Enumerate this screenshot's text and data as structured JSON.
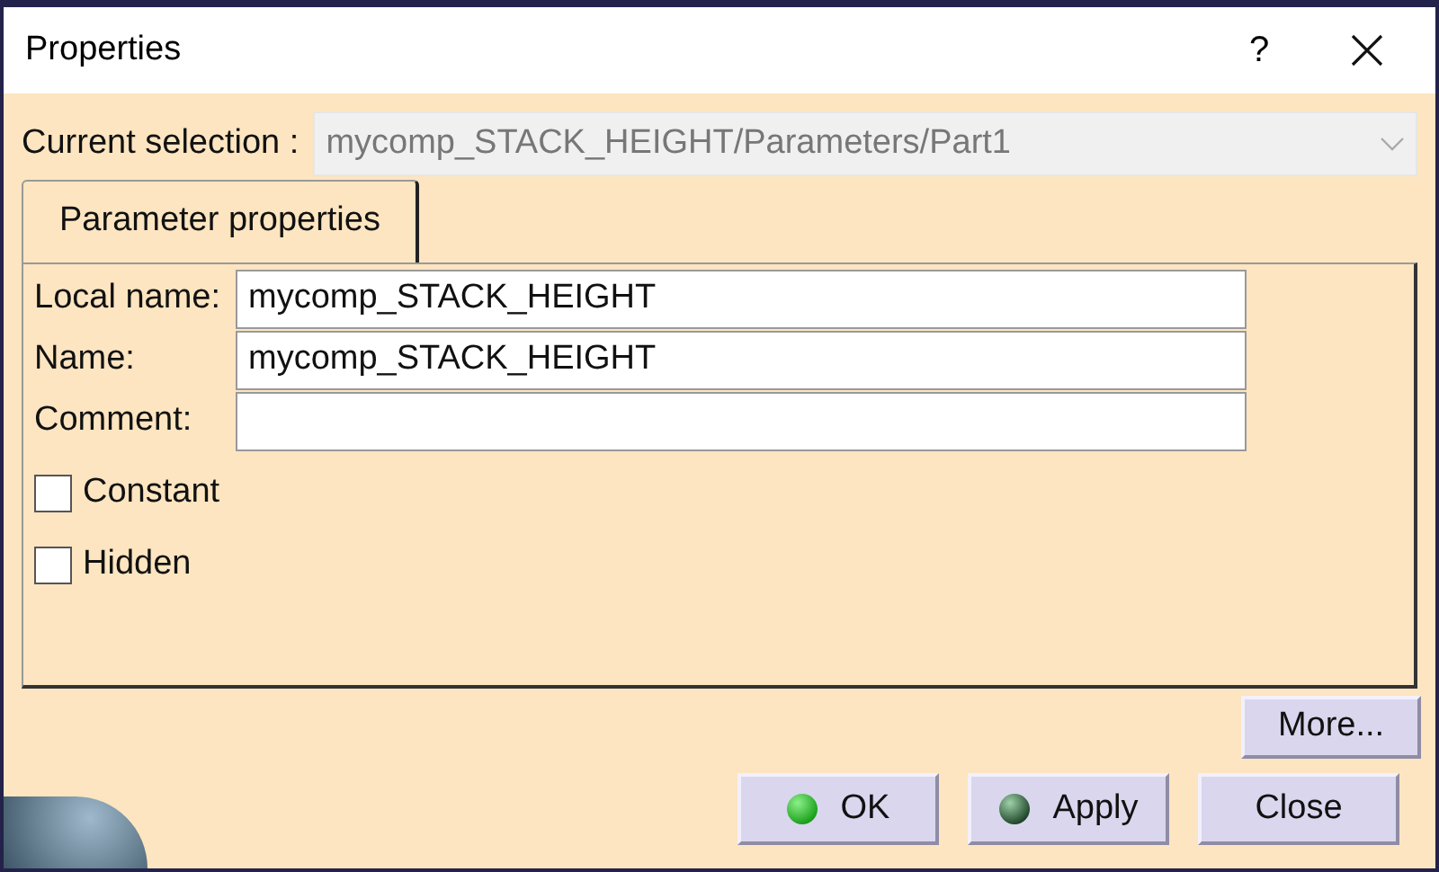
{
  "window": {
    "title": "Properties",
    "help": "?"
  },
  "current_selection": {
    "label": "Current selection :",
    "value": "mycomp_STACK_HEIGHT/Parameters/Part1",
    "disabled": true
  },
  "tabs": [
    {
      "label": "Parameter properties",
      "selected": true
    }
  ],
  "fields": [
    {
      "label": "Local name:",
      "value": "mycomp_STACK_HEIGHT"
    },
    {
      "label": "Name:",
      "value": "mycomp_STACK_HEIGHT"
    },
    {
      "label": "Comment:"
    }
  ],
  "checkboxes": [
    {
      "label": "Constant",
      "checked": false
    },
    {
      "label": "Hidden",
      "checked": false
    }
  ],
  "more_button": "More...",
  "buttons": [
    {
      "label": "OK",
      "kind": "ok"
    },
    {
      "label": "Apply",
      "kind": "apply"
    },
    {
      "label": "Close",
      "kind": "plain"
    }
  ]
}
